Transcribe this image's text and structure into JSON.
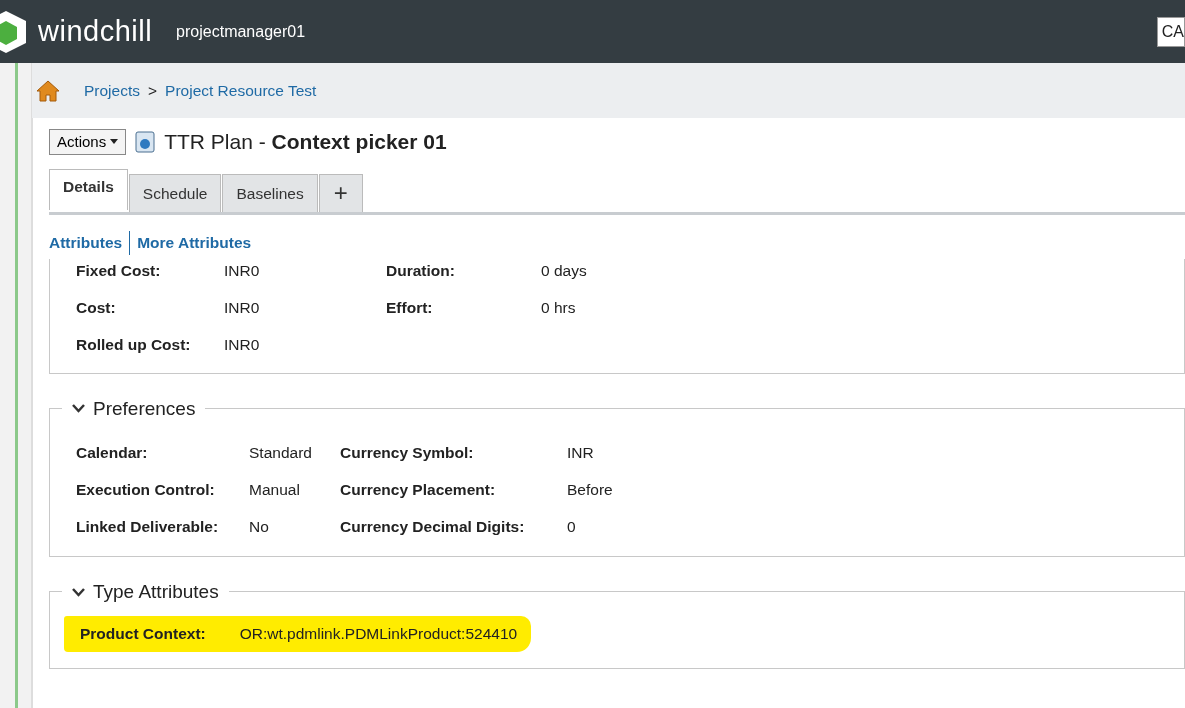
{
  "header": {
    "logo_text": "windchill",
    "user": "projectmanager01",
    "search_value": "CA"
  },
  "breadcrumb": [
    {
      "label": "Projects"
    },
    {
      "label": "Project Resource Test"
    }
  ],
  "breadcrumb_separator": ">",
  "actions_label": "Actions",
  "title": {
    "prefix": "TTR Plan - ",
    "name": "Context picker 01"
  },
  "tabs": [
    {
      "label": "Details",
      "selected": true
    },
    {
      "label": "Schedule",
      "selected": false
    },
    {
      "label": "Baselines",
      "selected": false
    },
    {
      "label": "+",
      "selected": false
    }
  ],
  "sub_tabs": [
    {
      "label": "Attributes"
    },
    {
      "label": "More Attributes"
    }
  ],
  "cost_rows": [
    {
      "label": "Fixed Cost:",
      "value": "INR0",
      "label2": "Duration:",
      "value2": "0 days"
    },
    {
      "label": "Cost:",
      "value": "INR0",
      "label2": "Effort:",
      "value2": "0 hrs"
    },
    {
      "label": "Rolled up Cost:",
      "value": "INR0"
    }
  ],
  "sections": [
    {
      "title": "Preferences",
      "expanded": true,
      "rows": [
        {
          "label": "Calendar:",
          "value": "Standard",
          "label2": "Currency Symbol:",
          "value2": "INR"
        },
        {
          "label": "Execution Control:",
          "value": "Manual",
          "label2": "Currency Placement:",
          "value2": "Before"
        },
        {
          "label": "Linked Deliverable:",
          "value": "No",
          "label2": "Currency Decimal Digits:",
          "value2": "0"
        }
      ]
    },
    {
      "title": "Type Attributes",
      "expanded": true,
      "highlighted": true,
      "rows": [
        {
          "label": "Product Context:",
          "value": "OR:wt.pdmlink.PDMLinkProduct:524410"
        }
      ]
    }
  ]
}
